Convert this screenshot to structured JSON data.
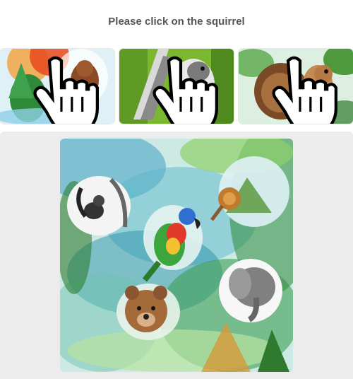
{
  "prompt": {
    "text": "Please click on the squirrel"
  },
  "examples": [
    {
      "subject": "squirrel",
      "cursor_icon": "pointer-hand-icon"
    },
    {
      "subject": "squirrel",
      "cursor_icon": "pointer-hand-icon"
    },
    {
      "subject": "squirrel",
      "cursor_icon": "pointer-hand-icon"
    }
  ],
  "puzzle": {
    "animals": [
      "squirrel",
      "parrot",
      "lion",
      "elephant",
      "bear"
    ],
    "style": "watercolor jungle"
  }
}
